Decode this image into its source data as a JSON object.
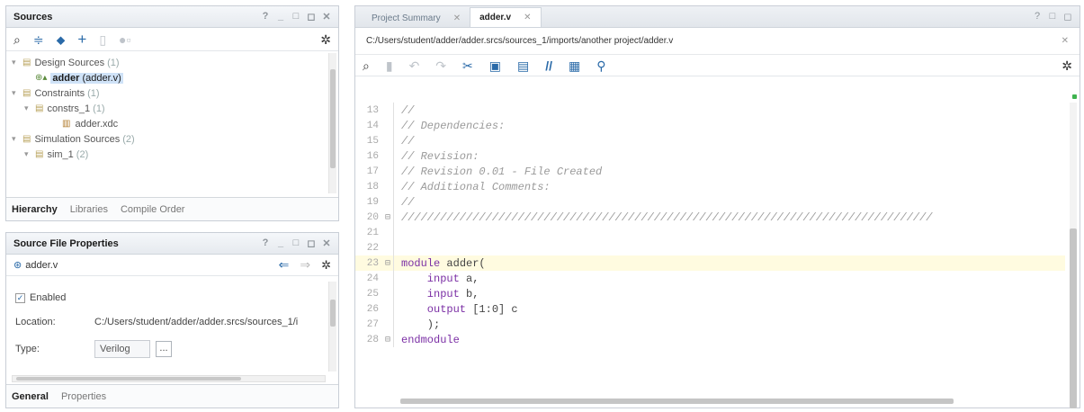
{
  "sources": {
    "title": "Sources",
    "tree": [
      {
        "label": "Design Sources",
        "count": "(1)",
        "level": 0,
        "exp": "▾"
      },
      {
        "label": "adder",
        "sub": "(adder.v)",
        "level": 1,
        "exp": ""
      },
      {
        "label": "Constraints",
        "count": "(1)",
        "level": 0,
        "exp": "▾"
      },
      {
        "label": "constrs_1",
        "count": "(1)",
        "level": 1,
        "exp": "▾"
      },
      {
        "label": "adder.xdc",
        "count": "",
        "level": 2,
        "exp": ""
      },
      {
        "label": "Simulation Sources",
        "count": "(2)",
        "level": 0,
        "exp": "▾"
      },
      {
        "label": "sim_1",
        "count": "(2)",
        "level": 1,
        "exp": "▾"
      }
    ],
    "tabs": [
      "Hierarchy",
      "Libraries",
      "Compile Order"
    ]
  },
  "props": {
    "title": "Source File Properties",
    "file": "adder.v",
    "enabled_label": "Enabled",
    "location_label": "Location:",
    "location_value": "C:/Users/student/adder/adder.srcs/sources_1/i",
    "type_label": "Type:",
    "type_value": "Verilog",
    "ellipsis": "...",
    "tabs": [
      "General",
      "Properties"
    ]
  },
  "editor": {
    "tabs": [
      "Project Summary",
      "adder.v"
    ],
    "path": "C:/Users/student/adder/adder.srcs/sources_1/imports/another project/adder.v",
    "lines": [
      {
        "n": "13",
        "t": "//",
        "c": "cm",
        "g": ""
      },
      {
        "n": "14",
        "t": "// Dependencies:",
        "c": "cm",
        "g": ""
      },
      {
        "n": "15",
        "t": "//",
        "c": "cm",
        "g": ""
      },
      {
        "n": "16",
        "t": "// Revision:",
        "c": "cm",
        "g": ""
      },
      {
        "n": "17",
        "t": "// Revision 0.01 - File Created",
        "c": "cm",
        "g": ""
      },
      {
        "n": "18",
        "t": "// Additional Comments:",
        "c": "cm",
        "g": ""
      },
      {
        "n": "19",
        "t": "//",
        "c": "cm",
        "g": ""
      },
      {
        "n": "20",
        "t": "//////////////////////////////////////////////////////////////////////////////////",
        "c": "cm",
        "g": "⊟"
      },
      {
        "n": "21",
        "t": "",
        "c": "id",
        "g": ""
      },
      {
        "n": "22",
        "t": "",
        "c": "id",
        "g": ""
      },
      {
        "n": "23",
        "k": "module",
        "t": " adder(",
        "c": "id",
        "g": "⊟",
        "hl": true
      },
      {
        "n": "24",
        "k": "    input",
        "t": " a,",
        "c": "id",
        "g": ""
      },
      {
        "n": "25",
        "k": "    input",
        "t": " b,",
        "c": "id",
        "g": ""
      },
      {
        "n": "26",
        "k": "    output",
        "t": " [1:0] c",
        "c": "id",
        "g": ""
      },
      {
        "n": "27",
        "t": "    );",
        "c": "id",
        "g": ""
      },
      {
        "n": "28",
        "k": "endmodule",
        "t": "",
        "c": "id",
        "g": "⊟"
      }
    ]
  },
  "icons": [
    "search-icon",
    "collapse-icon",
    "expand-icon",
    "add-icon",
    "file-icon",
    "gear-icon",
    "back-arrow-icon",
    "forward-arrow-icon",
    "save-icon",
    "undo-icon",
    "redo-icon",
    "cut-icon",
    "copy-icon",
    "paste-icon",
    "comment-icon",
    "columns-icon",
    "bulb-icon",
    "close-icon"
  ]
}
